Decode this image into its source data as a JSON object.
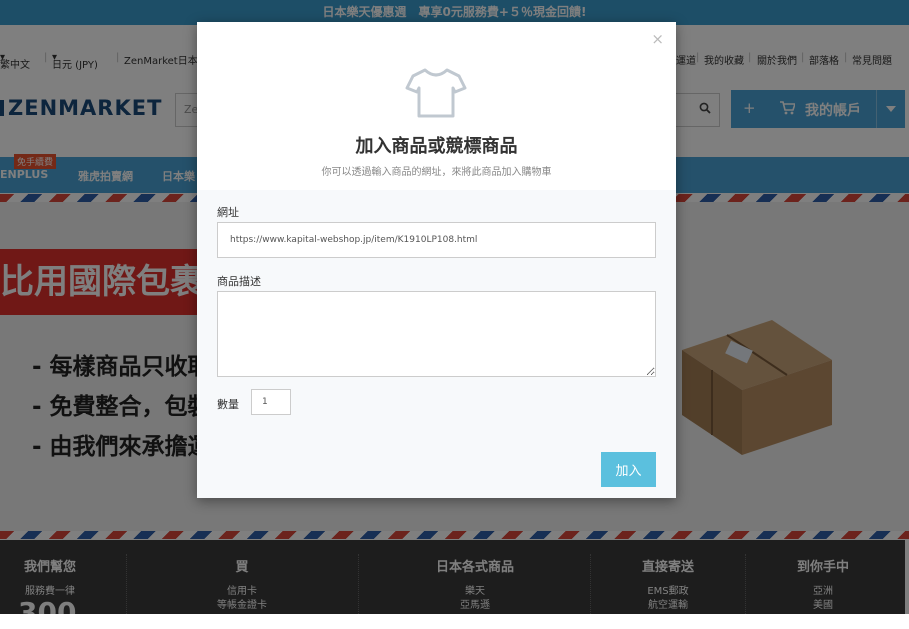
{
  "promo": {
    "text": "日本樂天優惠週　專享0元服務費+５％現金回饋!"
  },
  "util": {
    "language": "繁中文",
    "currency": "日元 (JPY)",
    "zenmarket": "ZenMarket日本",
    "shipping": "運道",
    "favorites": "我的收藏",
    "about": "關於我們",
    "blog": "部落格",
    "faq": "常見問題"
  },
  "header": {
    "logo": "ZENMARKET",
    "search_placeholder": "Ze",
    "account_plus": "+",
    "account_label": "我的帳戶"
  },
  "nav": {
    "badge": "免手續費",
    "items": [
      "ENPLUS",
      "雅虎拍賣網",
      "日本樂"
    ]
  },
  "banner": {
    "red_text": "比用國際包裹",
    "lines": [
      "- 每樣商品只收取",
      "- 免費整合，包裝",
      "- 由我們來承擔運"
    ]
  },
  "footer": {
    "cols": [
      {
        "title": "我們幫您",
        "sub": [
          "服務費一律"
        ]
      },
      {
        "title": "買",
        "sub": [
          "信用卡",
          "等帳金證卡"
        ]
      },
      {
        "title": "日本各式商品",
        "sub": [
          "樂天",
          "亞馬遜"
        ]
      },
      {
        "title": "直接寄送",
        "sub": [
          "EMS郵政",
          "航空運輸"
        ]
      },
      {
        "title": "到你手中",
        "sub": [
          "亞洲",
          "美國"
        ]
      }
    ],
    "big": "300"
  },
  "modal": {
    "close": "×",
    "icon": "tshirt-icon",
    "title": "加入商品或競標商品",
    "subtitle": "你可以透過輸入商品的網址，來將此商品加入購物車",
    "url_label": "網址",
    "url_value": "https://www.kapital-webshop.jp/item/K1910LP108.html",
    "desc_label": "商品描述",
    "desc_value": "",
    "qty_label": "數量",
    "qty_value": "1",
    "add_button": "加入"
  },
  "colors": {
    "accent": "#4aa3d6",
    "add_button": "#5bc0de",
    "promo": "#3a9ccf",
    "banner_red": "#e0302d"
  }
}
